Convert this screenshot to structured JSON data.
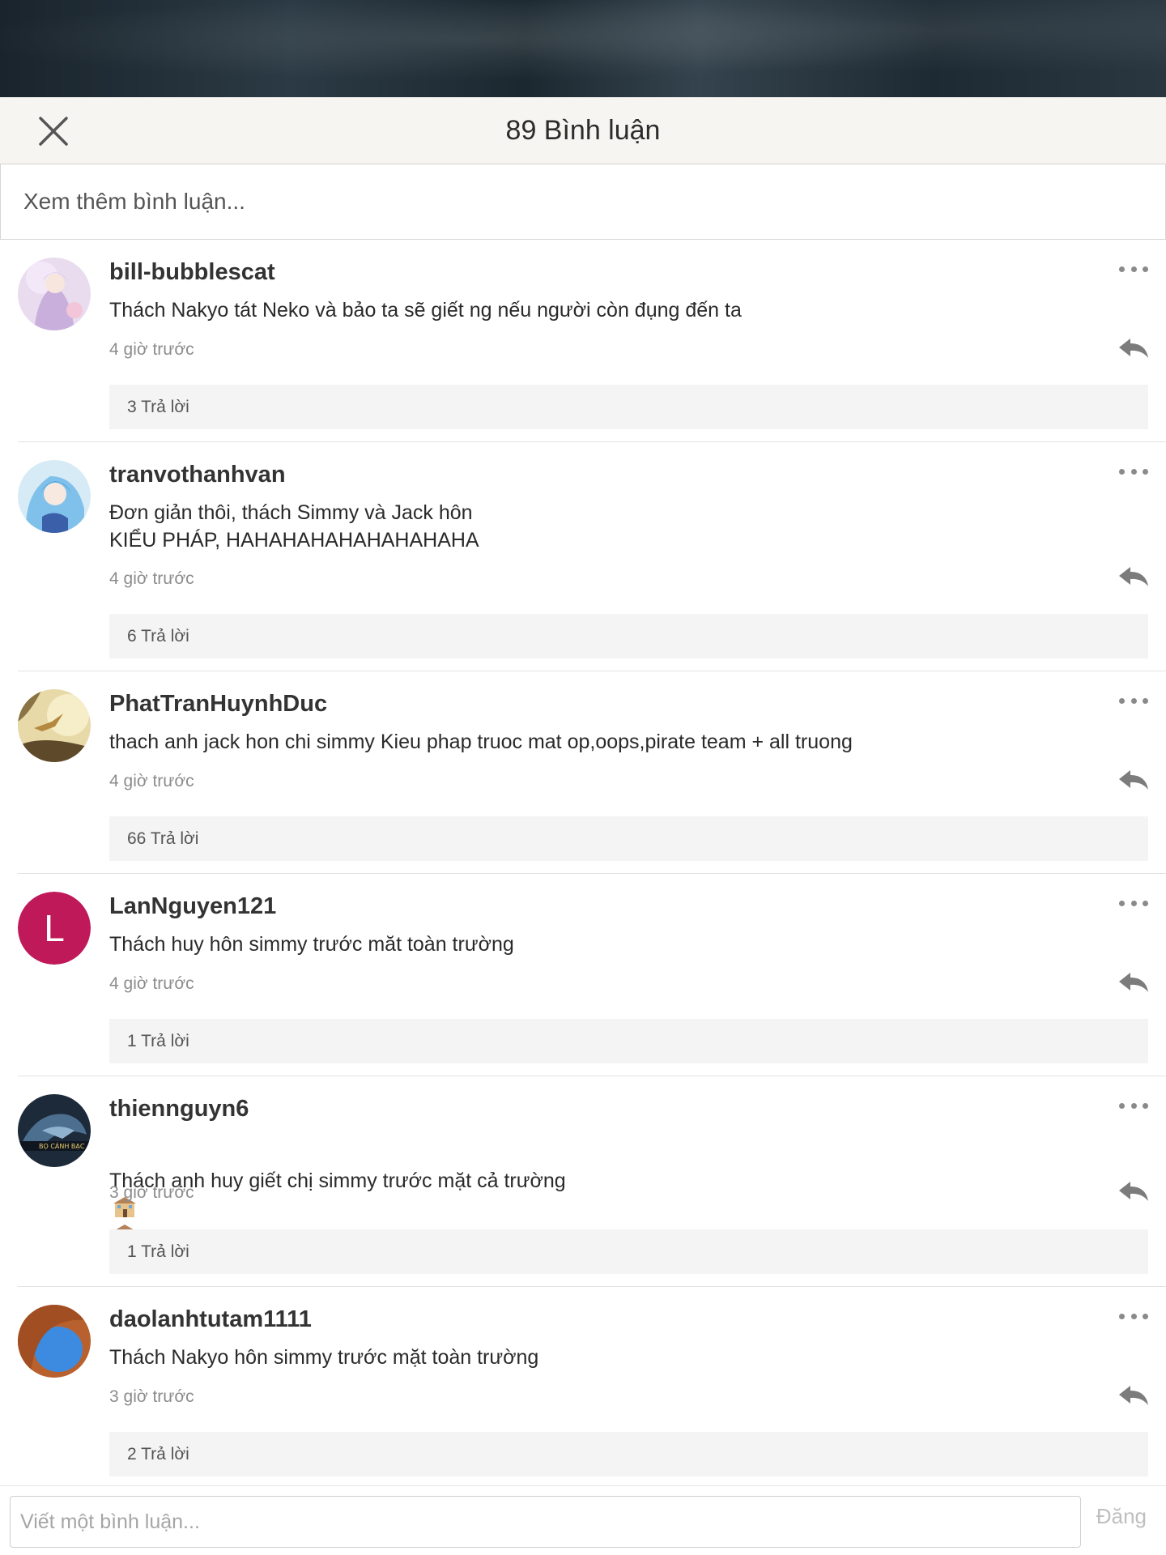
{
  "header": {
    "title": "89 Bình luận"
  },
  "more_comments_label": "Xem thêm bình luận...",
  "comments": [
    {
      "username": "bill-bubblescat",
      "text": "Thách Nakyo tát Neko và bảo ta sẽ giết ng nếu người còn đụng đến ta",
      "time": "4 giờ trước",
      "replies": "3 Trả lời",
      "avatar": "anime-girl-lilac"
    },
    {
      "username": "tranvothanhvan",
      "text": "Đơn giản thôi, thách Simmy và Jack hôn\nKIỂU PHÁP, HAHAHAHAHAHAHAHAHA",
      "time": "4 giờ trước",
      "replies": "6 Trả lời",
      "avatar": "anime-girl-blue"
    },
    {
      "username": "PhatTranHuynhDuc",
      "text": "thach anh jack hon chi simmy Kieu phap truoc mat op,oops,pirate team + all truong",
      "time": "4 giờ trước",
      "replies": "66 Trả lời",
      "avatar": "bird-sunset"
    },
    {
      "username": "LanNguyen121",
      "text": "Thách huy hôn simmy trước măt toàn trường",
      "time": "4 giờ trước",
      "replies": "1 Trả lời",
      "avatar_letter": "L",
      "avatar_color": "#c0195a"
    },
    {
      "username": "thiennguyn6",
      "text": "Thách anh huy giết chị simmy trước mặt cả trường",
      "time": "3 giờ trước",
      "replies": "1 Trả lời",
      "avatar": "dragon-dark",
      "avatar_caption": "BỌ CÁNH BẠC"
    },
    {
      "username": "daolanhtutam1111",
      "text": "Thách Nakyo hôn simmy trước mặt toàn trường",
      "time": "3 giờ trước",
      "replies": "2 Trả lời",
      "avatar": "rock-arch"
    }
  ],
  "composer": {
    "placeholder": "Viết một bình luận...",
    "post_label": "Đăng"
  }
}
